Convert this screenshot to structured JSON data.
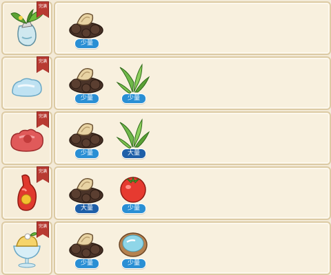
{
  "recipes": [
    {
      "dish_icon": "herb-bottle-icon",
      "tag": "完满",
      "ingredients": [
        {
          "icon": "mushroom-dirt-icon",
          "amount": "少量"
        }
      ]
    },
    {
      "dish_icon": "blue-jelly-icon",
      "tag": "完满",
      "ingredients": [
        {
          "icon": "mushroom-dirt-icon",
          "amount": "少量"
        },
        {
          "icon": "green-herb-icon",
          "amount": "少量"
        }
      ]
    },
    {
      "dish_icon": "red-jelly-icon",
      "tag": "完满",
      "ingredients": [
        {
          "icon": "mushroom-dirt-icon",
          "amount": "少量"
        },
        {
          "icon": "green-herb-icon",
          "amount": "大量"
        }
      ]
    },
    {
      "dish_icon": "red-bottle-icon",
      "tag": "完满",
      "ingredients": [
        {
          "icon": "mushroom-dirt-icon",
          "amount": "大量"
        },
        {
          "icon": "tomato-icon",
          "amount": "少量"
        }
      ]
    },
    {
      "dish_icon": "parfait-icon",
      "tag": "完满",
      "ingredients": [
        {
          "icon": "mushroom-dirt-icon",
          "amount": "少量"
        },
        {
          "icon": "water-bowl-icon",
          "amount": "少量"
        }
      ]
    }
  ],
  "colors": {
    "badge_light": "#2a8fd4",
    "badge_dark": "#1e5fa8",
    "ribbon": "#b83a32"
  }
}
